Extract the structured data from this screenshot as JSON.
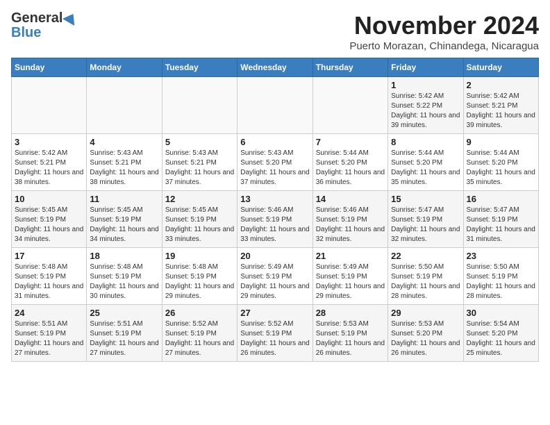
{
  "header": {
    "logo_general": "General",
    "logo_blue": "Blue",
    "month_title": "November 2024",
    "subtitle": "Puerto Morazan, Chinandega, Nicaragua"
  },
  "days_of_week": [
    "Sunday",
    "Monday",
    "Tuesday",
    "Wednesday",
    "Thursday",
    "Friday",
    "Saturday"
  ],
  "weeks": [
    [
      {
        "day": "",
        "info": ""
      },
      {
        "day": "",
        "info": ""
      },
      {
        "day": "",
        "info": ""
      },
      {
        "day": "",
        "info": ""
      },
      {
        "day": "",
        "info": ""
      },
      {
        "day": "1",
        "info": "Sunrise: 5:42 AM\nSunset: 5:22 PM\nDaylight: 11 hours and 39 minutes."
      },
      {
        "day": "2",
        "info": "Sunrise: 5:42 AM\nSunset: 5:21 PM\nDaylight: 11 hours and 39 minutes."
      }
    ],
    [
      {
        "day": "3",
        "info": "Sunrise: 5:42 AM\nSunset: 5:21 PM\nDaylight: 11 hours and 38 minutes."
      },
      {
        "day": "4",
        "info": "Sunrise: 5:43 AM\nSunset: 5:21 PM\nDaylight: 11 hours and 38 minutes."
      },
      {
        "day": "5",
        "info": "Sunrise: 5:43 AM\nSunset: 5:21 PM\nDaylight: 11 hours and 37 minutes."
      },
      {
        "day": "6",
        "info": "Sunrise: 5:43 AM\nSunset: 5:20 PM\nDaylight: 11 hours and 37 minutes."
      },
      {
        "day": "7",
        "info": "Sunrise: 5:44 AM\nSunset: 5:20 PM\nDaylight: 11 hours and 36 minutes."
      },
      {
        "day": "8",
        "info": "Sunrise: 5:44 AM\nSunset: 5:20 PM\nDaylight: 11 hours and 35 minutes."
      },
      {
        "day": "9",
        "info": "Sunrise: 5:44 AM\nSunset: 5:20 PM\nDaylight: 11 hours and 35 minutes."
      }
    ],
    [
      {
        "day": "10",
        "info": "Sunrise: 5:45 AM\nSunset: 5:19 PM\nDaylight: 11 hours and 34 minutes."
      },
      {
        "day": "11",
        "info": "Sunrise: 5:45 AM\nSunset: 5:19 PM\nDaylight: 11 hours and 34 minutes."
      },
      {
        "day": "12",
        "info": "Sunrise: 5:45 AM\nSunset: 5:19 PM\nDaylight: 11 hours and 33 minutes."
      },
      {
        "day": "13",
        "info": "Sunrise: 5:46 AM\nSunset: 5:19 PM\nDaylight: 11 hours and 33 minutes."
      },
      {
        "day": "14",
        "info": "Sunrise: 5:46 AM\nSunset: 5:19 PM\nDaylight: 11 hours and 32 minutes."
      },
      {
        "day": "15",
        "info": "Sunrise: 5:47 AM\nSunset: 5:19 PM\nDaylight: 11 hours and 32 minutes."
      },
      {
        "day": "16",
        "info": "Sunrise: 5:47 AM\nSunset: 5:19 PM\nDaylight: 11 hours and 31 minutes."
      }
    ],
    [
      {
        "day": "17",
        "info": "Sunrise: 5:48 AM\nSunset: 5:19 PM\nDaylight: 11 hours and 31 minutes."
      },
      {
        "day": "18",
        "info": "Sunrise: 5:48 AM\nSunset: 5:19 PM\nDaylight: 11 hours and 30 minutes."
      },
      {
        "day": "19",
        "info": "Sunrise: 5:48 AM\nSunset: 5:19 PM\nDaylight: 11 hours and 29 minutes."
      },
      {
        "day": "20",
        "info": "Sunrise: 5:49 AM\nSunset: 5:19 PM\nDaylight: 11 hours and 29 minutes."
      },
      {
        "day": "21",
        "info": "Sunrise: 5:49 AM\nSunset: 5:19 PM\nDaylight: 11 hours and 29 minutes."
      },
      {
        "day": "22",
        "info": "Sunrise: 5:50 AM\nSunset: 5:19 PM\nDaylight: 11 hours and 28 minutes."
      },
      {
        "day": "23",
        "info": "Sunrise: 5:50 AM\nSunset: 5:19 PM\nDaylight: 11 hours and 28 minutes."
      }
    ],
    [
      {
        "day": "24",
        "info": "Sunrise: 5:51 AM\nSunset: 5:19 PM\nDaylight: 11 hours and 27 minutes."
      },
      {
        "day": "25",
        "info": "Sunrise: 5:51 AM\nSunset: 5:19 PM\nDaylight: 11 hours and 27 minutes."
      },
      {
        "day": "26",
        "info": "Sunrise: 5:52 AM\nSunset: 5:19 PM\nDaylight: 11 hours and 27 minutes."
      },
      {
        "day": "27",
        "info": "Sunrise: 5:52 AM\nSunset: 5:19 PM\nDaylight: 11 hours and 26 minutes."
      },
      {
        "day": "28",
        "info": "Sunrise: 5:53 AM\nSunset: 5:19 PM\nDaylight: 11 hours and 26 minutes."
      },
      {
        "day": "29",
        "info": "Sunrise: 5:53 AM\nSunset: 5:20 PM\nDaylight: 11 hours and 26 minutes."
      },
      {
        "day": "30",
        "info": "Sunrise: 5:54 AM\nSunset: 5:20 PM\nDaylight: 11 hours and 25 minutes."
      }
    ]
  ]
}
